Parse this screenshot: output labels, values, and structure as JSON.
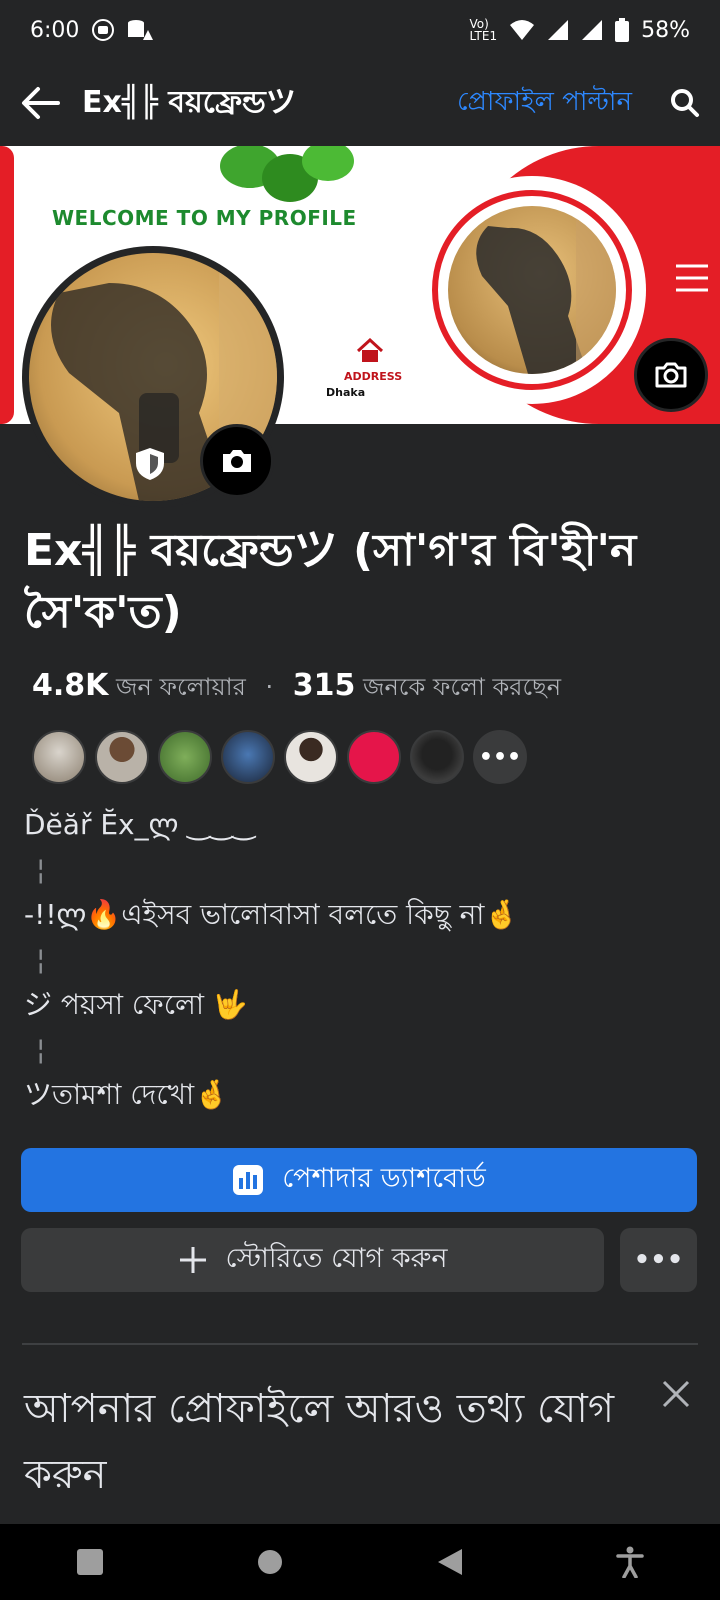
{
  "status_bar": {
    "time": "6:00",
    "battery": "58%"
  },
  "header": {
    "title": "Ex╣╠ বয়ফ্রেন্ডツ",
    "switch_profile": "প্রোফাইল পাল্টান"
  },
  "cover": {
    "welcome_text": "WELCOME TO MY PROFILE",
    "address_label": "ADDRESS",
    "city": "Dhaka"
  },
  "profile": {
    "name": "Ex╣╠ বয়ফ্রেন্ডツ (সা'গ'র বি'হী'ন সৈ'ক'ত)",
    "followers_count": "4.8K",
    "followers_label": "জন ফলোয়ার",
    "following_count": "315",
    "following_label": "জনকে ফলো করছেন",
    "more_friends": "•••"
  },
  "bio": {
    "line1": "Ďĕăř Ĕx_ლ ‿‿‿",
    "sep1": "¦",
    "line2": "-!!ლ🔥এইসব ভালোবাসা  বলতে কিছু না🤞",
    "sep2": "¦",
    "line3": "ジ পয়সা ফেলো 🤟",
    "sep3": "¦",
    "line4": "ツতামশা দেখো🤞"
  },
  "actions": {
    "dashboard_label": "পেশাদার ড্যাশবোর্ড",
    "add_story_label": "স্টোরিতে যোগ করুন",
    "more_label": "•••"
  },
  "prompt": {
    "title": "আপনার প্রোফাইলে আরও তথ্য যোগ করুন"
  },
  "colors": {
    "background": "#242526",
    "accent_blue": "#2374e1",
    "link_blue": "#2d88ff",
    "cover_red": "#e41e26"
  }
}
